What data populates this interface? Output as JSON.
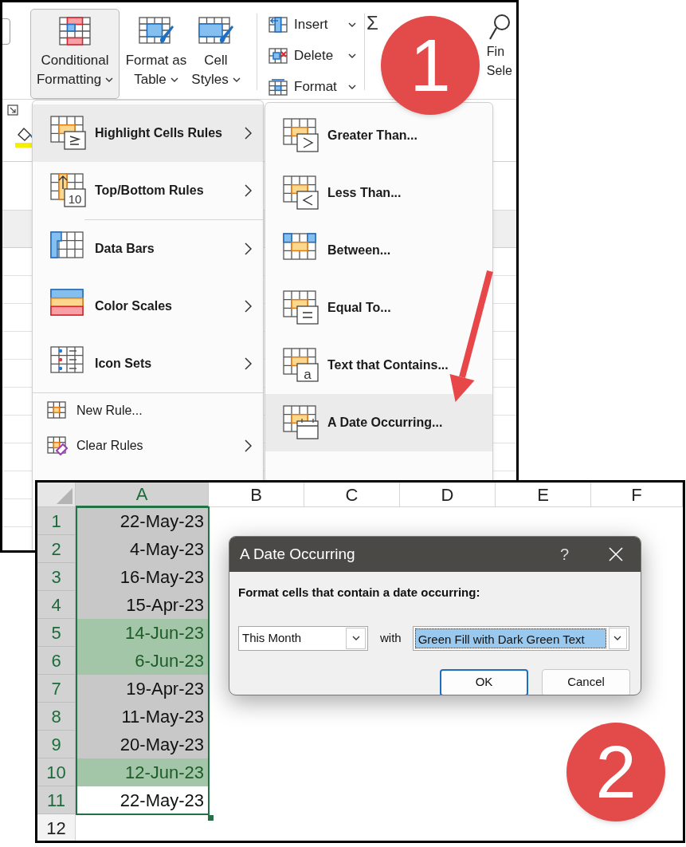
{
  "ribbon": {
    "large_buttons": [
      {
        "lines": [
          "Conditional",
          "Formatting"
        ],
        "selected": true
      },
      {
        "lines": [
          "Format as",
          "Table"
        ],
        "selected": false
      },
      {
        "lines": [
          "Cell",
          "Styles"
        ],
        "selected": false
      }
    ],
    "cells_buttons": [
      {
        "label": "Insert"
      },
      {
        "label": "Delete"
      },
      {
        "label": "Format"
      }
    ],
    "editing": {
      "sum_symbol": "Σ",
      "find_lines": [
        "Fin",
        "Sele"
      ]
    }
  },
  "menu": {
    "items": [
      {
        "label": "Highlight Cells Rules",
        "kind": "large",
        "submenu": true,
        "separator_before": false,
        "selected": true
      },
      {
        "label": "Top/Bottom Rules",
        "kind": "large",
        "icon_text": "10",
        "submenu": true,
        "separator_before": false,
        "selected": false
      },
      {
        "label": "Data Bars",
        "kind": "large",
        "submenu": true,
        "separator_before": true,
        "selected": false
      },
      {
        "label": "Color Scales",
        "kind": "large",
        "submenu": true,
        "separator_before": false,
        "selected": false
      },
      {
        "label": "Icon Sets",
        "kind": "large",
        "submenu": true,
        "separator_before": false,
        "selected": false
      },
      {
        "label": "New Rule...",
        "kind": "small",
        "submenu": false,
        "separator_before": true,
        "selected": false
      },
      {
        "label": "Clear Rules",
        "kind": "small",
        "submenu": true,
        "separator_before": false,
        "selected": false
      }
    ]
  },
  "submenu": {
    "items": [
      {
        "label": "Greater Than...",
        "selected": false
      },
      {
        "label": "Less Than...",
        "selected": false
      },
      {
        "label": "Between...",
        "selected": false
      },
      {
        "label": "Equal To...",
        "selected": false
      },
      {
        "label": "Text that Contains...",
        "icon_text": "a",
        "selected": false
      },
      {
        "label": "A Date Occurring...",
        "selected": true
      }
    ]
  },
  "spreadsheet": {
    "columns": [
      {
        "label": "A",
        "selected": true
      },
      {
        "label": "B",
        "selected": false
      },
      {
        "label": "C",
        "selected": false
      },
      {
        "label": "D",
        "selected": false
      },
      {
        "label": "E",
        "selected": false
      },
      {
        "label": "F",
        "selected": false
      }
    ],
    "rows": [
      {
        "label": "1",
        "value": "22-May-23",
        "selected": true,
        "active": false,
        "highlighted": false
      },
      {
        "label": "2",
        "value": "4-May-23",
        "selected": true,
        "active": false,
        "highlighted": false
      },
      {
        "label": "3",
        "value": "16-May-23",
        "selected": true,
        "active": false,
        "highlighted": false
      },
      {
        "label": "4",
        "value": "15-Apr-23",
        "selected": true,
        "active": false,
        "highlighted": false
      },
      {
        "label": "5",
        "value": "14-Jun-23",
        "selected": true,
        "active": false,
        "highlighted": true
      },
      {
        "label": "6",
        "value": "6-Jun-23",
        "selected": true,
        "active": false,
        "highlighted": true
      },
      {
        "label": "7",
        "value": "19-Apr-23",
        "selected": true,
        "active": false,
        "highlighted": false
      },
      {
        "label": "8",
        "value": "11-May-23",
        "selected": true,
        "active": false,
        "highlighted": false
      },
      {
        "label": "9",
        "value": "20-May-23",
        "selected": true,
        "active": false,
        "highlighted": false
      },
      {
        "label": "10",
        "value": "12-Jun-23",
        "selected": true,
        "active": false,
        "highlighted": true
      },
      {
        "label": "11",
        "value": "22-May-23",
        "selected": true,
        "active": true,
        "highlighted": false
      },
      {
        "label": "12",
        "selected": false
      }
    ]
  },
  "dialog": {
    "title": "A Date Occurring",
    "help": "?",
    "prompt": "Format cells that contain a date occurring:",
    "period": {
      "value": "This Month"
    },
    "connector": "with",
    "format": {
      "value": "Green Fill with Dark Green Text",
      "focused": true
    },
    "buttons": [
      {
        "label": "OK",
        "default": true
      },
      {
        "label": "Cancel",
        "default": false
      }
    ]
  },
  "badges": [
    {
      "text": "1"
    },
    {
      "text": "2"
    }
  ]
}
